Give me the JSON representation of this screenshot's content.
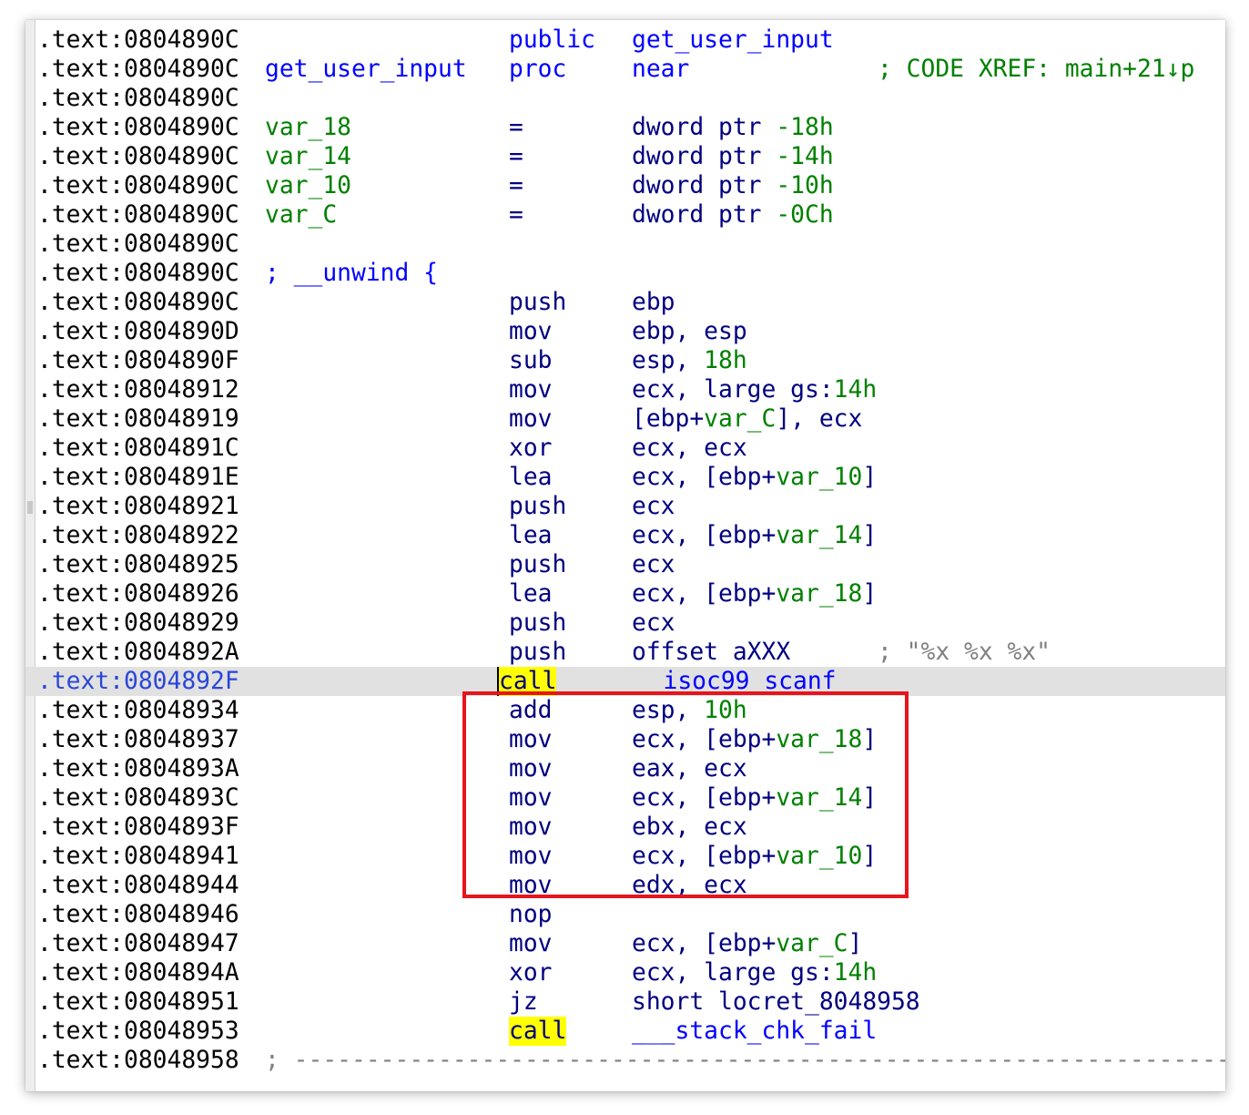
{
  "listing": {
    "lines": [
      {
        "addr": ".text:0804890C",
        "name": "",
        "mn": "public",
        "op": "get_user_input",
        "cmt": ""
      },
      {
        "addr": ".text:0804890C",
        "name": "get_user_input",
        "mn": "proc",
        "op": "near",
        "cmt": "; CODE XREF: main+21↓p"
      },
      {
        "addr": ".text:0804890C",
        "name": "",
        "mn": "",
        "op": "",
        "cmt": ""
      },
      {
        "addr": ".text:0804890C",
        "name": "var_18",
        "mn": "=",
        "op": "dword ptr -18h",
        "cmt": ""
      },
      {
        "addr": ".text:0804890C",
        "name": "var_14",
        "mn": "=",
        "op": "dword ptr -14h",
        "cmt": ""
      },
      {
        "addr": ".text:0804890C",
        "name": "var_10",
        "mn": "=",
        "op": "dword ptr -10h",
        "cmt": ""
      },
      {
        "addr": ".text:0804890C",
        "name": "var_C",
        "mn": "=",
        "op": "dword ptr -0Ch",
        "cmt": ""
      },
      {
        "addr": ".text:0804890C",
        "name": "",
        "mn": "",
        "op": "",
        "cmt": ""
      },
      {
        "addr": ".text:0804890C",
        "name": "; __unwind {",
        "mn": "",
        "op": "",
        "cmt": ""
      },
      {
        "addr": ".text:0804890C",
        "name": "",
        "mn": "push",
        "op": "ebp",
        "cmt": ""
      },
      {
        "addr": ".text:0804890D",
        "name": "",
        "mn": "mov",
        "op": "ebp, esp",
        "cmt": ""
      },
      {
        "addr": ".text:0804890F",
        "name": "",
        "mn": "sub",
        "op": "esp, 18h",
        "cmt": ""
      },
      {
        "addr": ".text:08048912",
        "name": "",
        "mn": "mov",
        "op": "ecx, large gs:14h",
        "cmt": ""
      },
      {
        "addr": ".text:08048919",
        "name": "",
        "mn": "mov",
        "op": "[ebp+var_C], ecx",
        "cmt": ""
      },
      {
        "addr": ".text:0804891C",
        "name": "",
        "mn": "xor",
        "op": "ecx, ecx",
        "cmt": ""
      },
      {
        "addr": ".text:0804891E",
        "name": "",
        "mn": "lea",
        "op": "ecx, [ebp+var_10]",
        "cmt": ""
      },
      {
        "addr": ".text:08048921",
        "name": "",
        "mn": "push",
        "op": "ecx",
        "cmt": ""
      },
      {
        "addr": ".text:08048922",
        "name": "",
        "mn": "lea",
        "op": "ecx, [ebp+var_14]",
        "cmt": ""
      },
      {
        "addr": ".text:08048925",
        "name": "",
        "mn": "push",
        "op": "ecx",
        "cmt": ""
      },
      {
        "addr": ".text:08048926",
        "name": "",
        "mn": "lea",
        "op": "ecx, [ebp+var_18]",
        "cmt": ""
      },
      {
        "addr": ".text:08048929",
        "name": "",
        "mn": "push",
        "op": "ecx",
        "cmt": ""
      },
      {
        "addr": ".text:0804892A",
        "name": "",
        "mn": "push",
        "op": "offset aXXX",
        "cmt": "; \"%x %x %x\""
      },
      {
        "addr": ".text:0804892F",
        "name": "",
        "mn": "call",
        "op": "___isoc99_scanf",
        "cmt": ""
      },
      {
        "addr": ".text:08048934",
        "name": "",
        "mn": "add",
        "op": "esp, 10h",
        "cmt": ""
      },
      {
        "addr": ".text:08048937",
        "name": "",
        "mn": "mov",
        "op": "ecx, [ebp+var_18]",
        "cmt": ""
      },
      {
        "addr": ".text:0804893A",
        "name": "",
        "mn": "mov",
        "op": "eax, ecx",
        "cmt": ""
      },
      {
        "addr": ".text:0804893C",
        "name": "",
        "mn": "mov",
        "op": "ecx, [ebp+var_14]",
        "cmt": ""
      },
      {
        "addr": ".text:0804893F",
        "name": "",
        "mn": "mov",
        "op": "ebx, ecx",
        "cmt": ""
      },
      {
        "addr": ".text:08048941",
        "name": "",
        "mn": "mov",
        "op": "ecx, [ebp+var_10]",
        "cmt": ""
      },
      {
        "addr": ".text:08048944",
        "name": "",
        "mn": "mov",
        "op": "edx, ecx",
        "cmt": ""
      },
      {
        "addr": ".text:08048946",
        "name": "",
        "mn": "nop",
        "op": "",
        "cmt": ""
      },
      {
        "addr": ".text:08048947",
        "name": "",
        "mn": "mov",
        "op": "ecx, [ebp+var_C]",
        "cmt": ""
      },
      {
        "addr": ".text:0804894A",
        "name": "",
        "mn": "xor",
        "op": "ecx, large gs:14h",
        "cmt": ""
      },
      {
        "addr": ".text:08048951",
        "name": "",
        "mn": "jz",
        "op": "short locret_8048958",
        "cmt": ""
      },
      {
        "addr": ".text:08048953",
        "name": "",
        "mn": "call",
        "op": "___stack_chk_fail",
        "cmt": ""
      },
      {
        "addr": ".text:08048958",
        "name": "; -------------------------------------------------------------------",
        "mn": "",
        "op": "",
        "cmt": ""
      }
    ],
    "current_line_index": 22
  },
  "colors": {
    "address": "#000000",
    "current_address": "#2a46d8",
    "instruction": "#000080",
    "immediate": "#008000",
    "comment_xref": "#008000",
    "string_comment": "#808080",
    "current_line_bg": "#e1e1e1",
    "call_highlight": "#ffff00",
    "annotation_box": "#e8141c"
  }
}
